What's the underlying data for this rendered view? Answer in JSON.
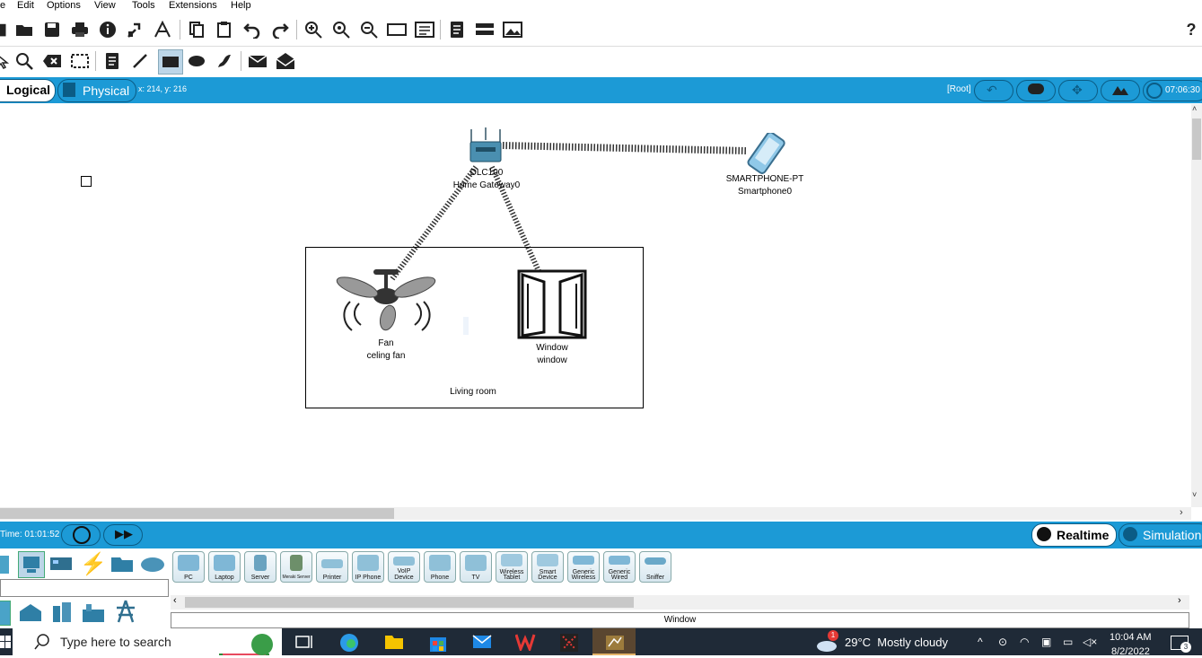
{
  "menu": {
    "items": [
      "Edit",
      "Options",
      "View",
      "Tools",
      "Extensions",
      "Help"
    ],
    "help_question": "?"
  },
  "topbar": {
    "logical_tab": "Logical",
    "physical_tab": "Physical",
    "coords": "x: 214, y: 216",
    "root_label": "[Root]",
    "clock": "07:06:30"
  },
  "canvas": {
    "gateway_model": "DLC100",
    "gateway_name": "Home Gateway0",
    "phone_model": "SMARTPHONE-PT",
    "phone_name": "Smartphone0",
    "fan_model": "Fan",
    "fan_name": "celing fan",
    "window_model": "Window",
    "window_name": "window",
    "room_label": "Living room"
  },
  "bottombar": {
    "time": "Time: 01:01:52",
    "realtime": "Realtime",
    "simulation": "Simulation"
  },
  "devices": [
    {
      "label": "PC",
      "icon": "pc-icon"
    },
    {
      "label": "Laptop",
      "icon": "laptop-icon"
    },
    {
      "label": "Server",
      "icon": "server-icon"
    },
    {
      "label": "Meraki Server",
      "icon": "meraki-server-icon"
    },
    {
      "label": "Printer",
      "icon": "printer-icon"
    },
    {
      "label": "IP Phone",
      "icon": "ip-phone-icon"
    },
    {
      "label": "VoIP Device",
      "icon": "voip-device-icon"
    },
    {
      "label": "Phone",
      "icon": "phone-icon"
    },
    {
      "label": "TV",
      "icon": "tv-icon"
    },
    {
      "label": "Wireless Tablet",
      "icon": "tablet-icon"
    },
    {
      "label": "Smart Device",
      "icon": "smart-device-icon"
    },
    {
      "label": "Generic Wireless",
      "icon": "generic-wireless-icon"
    },
    {
      "label": "Generic Wired",
      "icon": "generic-wired-icon"
    },
    {
      "label": "Sniffer",
      "icon": "sniffer-icon"
    }
  ],
  "device_status": "Window",
  "taskbar": {
    "search_placeholder": "Type here to search",
    "weather": "29°C  Mostly cloudy",
    "weather_badge": "1",
    "time": "10:04 AM",
    "date": "8/2/2022",
    "notif_count": "3"
  },
  "colors": {
    "accent_blue": "#1c9ad6",
    "taskbar": "#1f2a37"
  }
}
